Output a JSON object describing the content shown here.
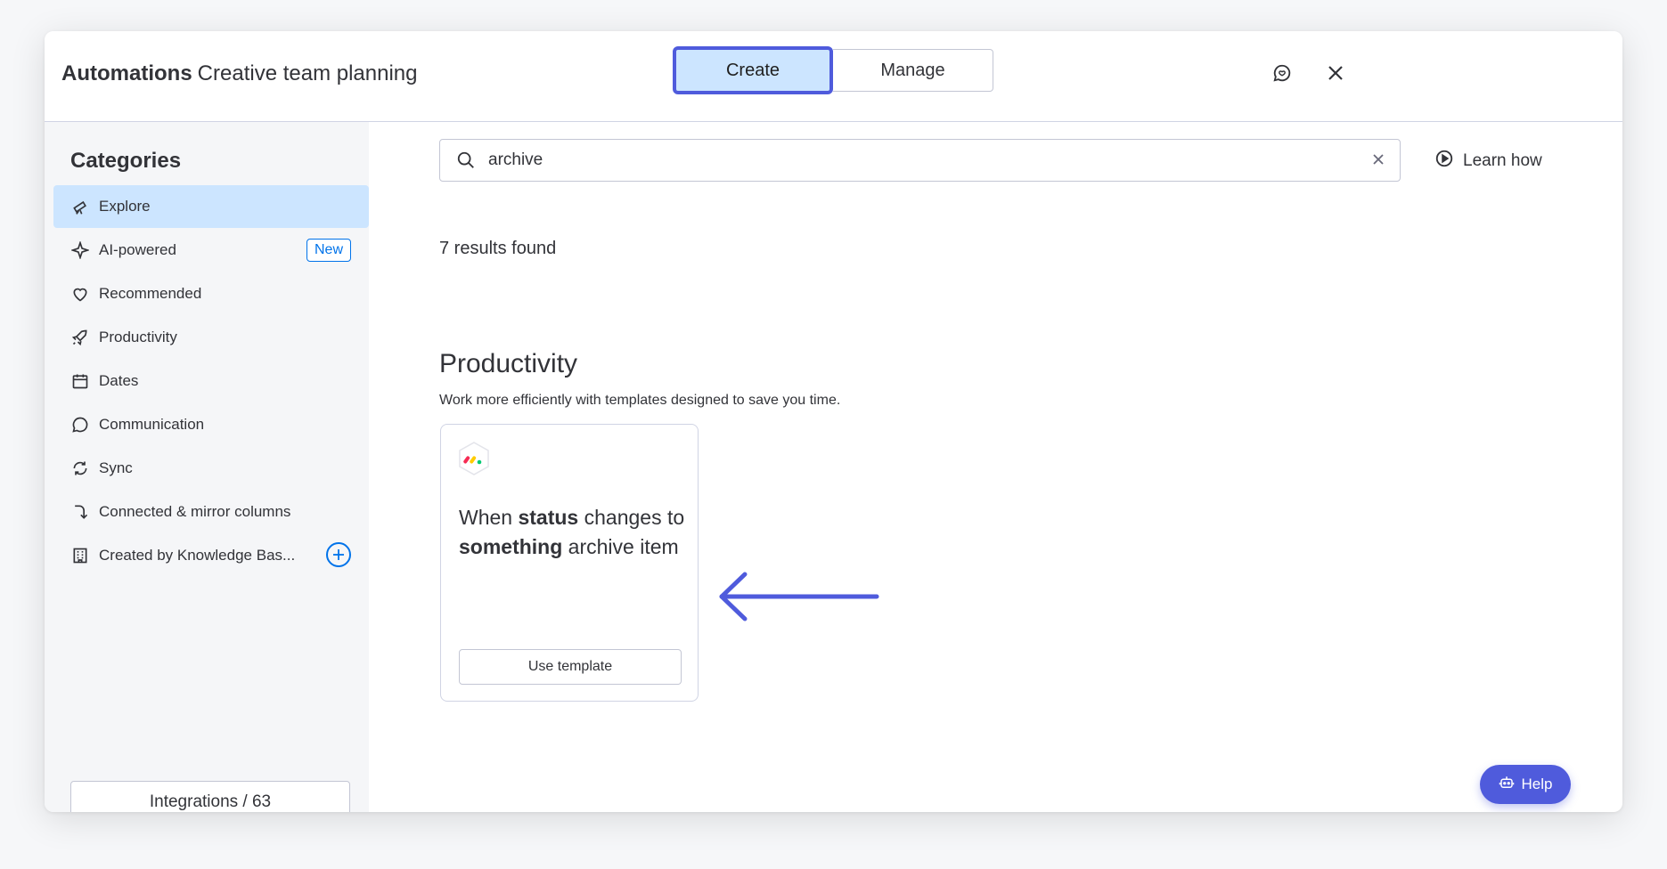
{
  "header": {
    "title_bold": "Automations",
    "title_sub": "Creative team planning",
    "tabs": [
      {
        "label": "Create",
        "active": true
      },
      {
        "label": "Manage",
        "active": false
      }
    ]
  },
  "sidebar": {
    "title": "Categories",
    "items": [
      {
        "label": "Explore",
        "icon": "telescope-icon",
        "active": true
      },
      {
        "label": "AI-powered",
        "icon": "sparkle-icon",
        "badge": "New"
      },
      {
        "label": "Recommended",
        "icon": "heart-icon"
      },
      {
        "label": "Productivity",
        "icon": "rocket-icon"
      },
      {
        "label": "Dates",
        "icon": "calendar-icon"
      },
      {
        "label": "Communication",
        "icon": "chat-bubble-icon"
      },
      {
        "label": "Sync",
        "icon": "sync-icon"
      },
      {
        "label": "Connected & mirror columns",
        "icon": "connect-arrow-icon"
      },
      {
        "label": "Created by Knowledge Bas...",
        "icon": "building-icon"
      }
    ],
    "integrations_label": "Integrations / 63",
    "integration_icons": [
      "outlook-icon",
      "gmail-icon",
      "slack-icon",
      "google-calendar-icon"
    ]
  },
  "search": {
    "value": "archive"
  },
  "learn_how": "Learn how",
  "results_text": "7 results found",
  "section": {
    "title": "Productivity",
    "description": "Work more efficiently with templates designed to save you time."
  },
  "card": {
    "t1": "When ",
    "b1": "status",
    "t2": " changes to ",
    "b2": "something",
    "t3": " archive item",
    "button": "Use template"
  },
  "help_label": "Help",
  "colors": {
    "accent": "#4f5bdc",
    "active_bg": "#cce5ff",
    "primary_blue": "#0073ea"
  }
}
